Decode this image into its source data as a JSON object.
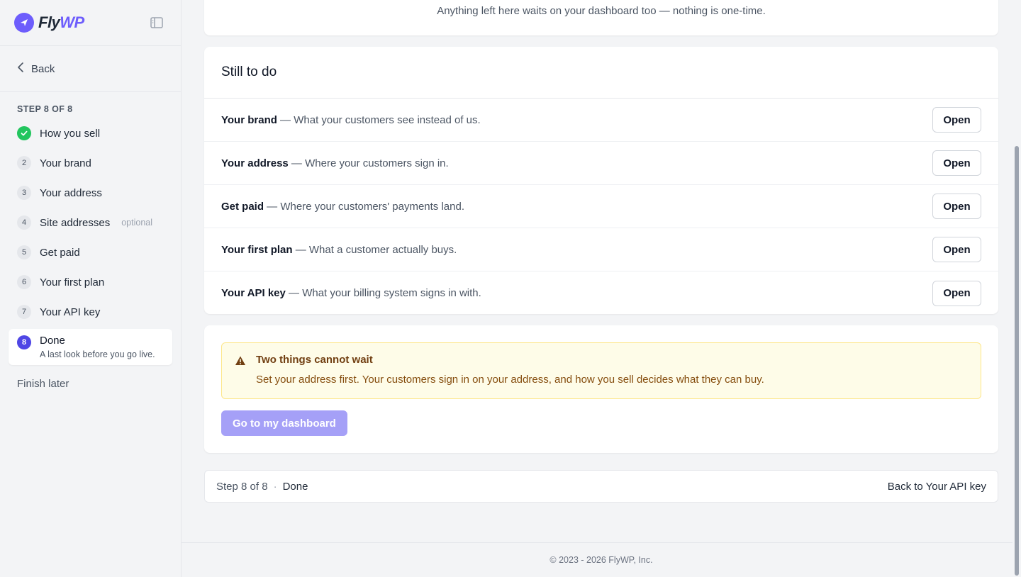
{
  "brand": {
    "name_part1": "Fly",
    "name_part2": "WP",
    "accent": "#6d5dfc"
  },
  "sidebar": {
    "back_label": "Back",
    "step_caption": "STEP 8 OF 8",
    "steps": [
      {
        "num": "",
        "label": "How you sell",
        "status": "done"
      },
      {
        "num": "2",
        "label": "Your brand"
      },
      {
        "num": "3",
        "label": "Your address"
      },
      {
        "num": "4",
        "label": "Site addresses",
        "tag": "optional"
      },
      {
        "num": "5",
        "label": "Get paid"
      },
      {
        "num": "6",
        "label": "Your first plan"
      },
      {
        "num": "7",
        "label": "Your API key"
      },
      {
        "num": "8",
        "label": "Done",
        "sub": "A last look before you go live.",
        "status": "active"
      }
    ],
    "finish_later": "Finish later"
  },
  "top_note": "Anything left here waits on your dashboard too — nothing is one-time.",
  "todo": {
    "title": "Still to do",
    "button_label": "Open",
    "items": [
      {
        "name": "Your brand",
        "desc": " — What your customers see instead of us."
      },
      {
        "name": "Your address",
        "desc": " — Where your customers sign in."
      },
      {
        "name": "Get paid",
        "desc": " — Where your customers' payments land."
      },
      {
        "name": "Your first plan",
        "desc": " — What a customer actually buys."
      },
      {
        "name": "Your API key",
        "desc": " — What your billing system signs in with."
      }
    ]
  },
  "alert": {
    "title": "Two things cannot wait",
    "body": "Set your address first. Your customers sign in on your address, and how you sell decides what they can buy."
  },
  "dashboard_button": "Go to my dashboard",
  "footer_bar": {
    "step": "Step 8 of 8",
    "dot": "·",
    "current": "Done",
    "back": "Back to Your API key"
  },
  "copyright": "© 2023 - 2026 FlyWP, Inc."
}
